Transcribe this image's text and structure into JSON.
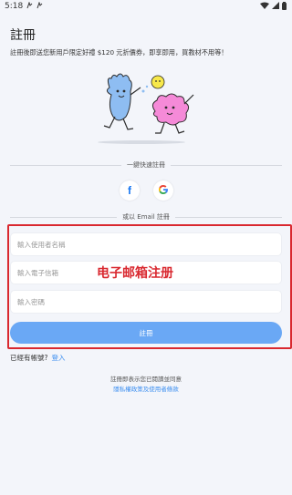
{
  "status_bar": {
    "time": "5:18"
  },
  "page": {
    "title": "註冊",
    "subtitle": "註冊後即送您新用戶限定好禮 $120 元折價券，即享即用，買教材不用等！"
  },
  "quick_register": {
    "label": "一鍵快速註冊",
    "facebook_glyph": "f",
    "google_glyph": "G"
  },
  "email_register": {
    "label": "或以 Email 註冊",
    "username_placeholder": "輸入使用者名稱",
    "email_placeholder": "輸入電子信箱",
    "password_placeholder": "輸入密碼",
    "submit_label": "註冊"
  },
  "annotation": {
    "text": "电子邮箱注册",
    "color": "#d9282f"
  },
  "login": {
    "prompt": "已經有帳號?",
    "link": "登入"
  },
  "terms": {
    "line1": "註冊即表示您已閱讀並同意",
    "line2": "隱私權政策及使用者條款"
  },
  "colors": {
    "accent": "#6aa8f5",
    "link": "#3d8ff0",
    "background": "#f3f5fa"
  }
}
